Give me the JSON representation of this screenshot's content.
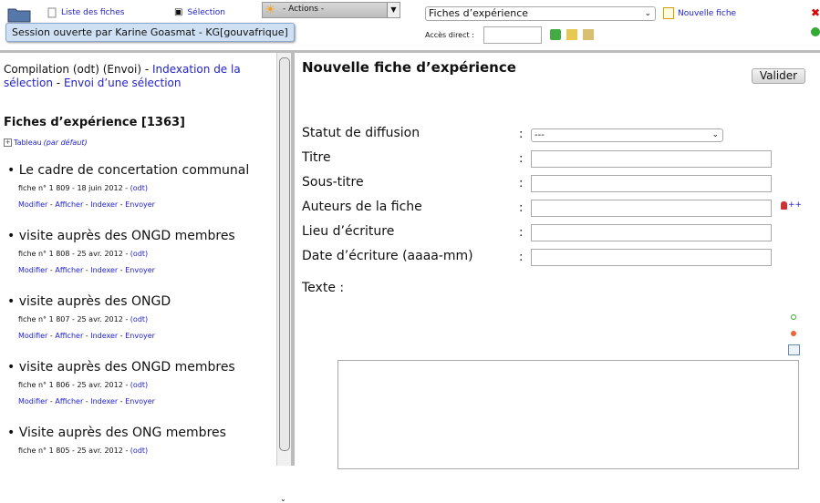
{
  "toolbar": {
    "liste_label": "Liste des fiches",
    "selection_label": "Sélection",
    "actions_label": "- Actions -",
    "type_select": "Fiches d’expérience",
    "new_fiche": "Nouvelle fiche",
    "acces_label": "Accès direct :",
    "acces_value": ""
  },
  "session": "Session ouverte par Karine Goasmat - KG[gouvafrique]",
  "left": {
    "compil_prefix": "Compilation (odt) (Envoi) -",
    "compil_link1": "Indexation de la sélection",
    "compil_sep": "-",
    "compil_link2": "Envoi d’une sélection",
    "fiches_title": "Fiches d’expérience [1363]",
    "tableau_label": "Tableau",
    "tableau_default": "(par défaut)",
    "odt": "(odt)",
    "actions": [
      "Modifier",
      "Afficher",
      "Indexer",
      "Envoyer"
    ],
    "entries": [
      {
        "title": "Le cadre de concertation communal",
        "meta": "fiche n° 1 809 - 18 juin 2012 -"
      },
      {
        "title": "visite auprès des ONGD membres",
        "meta": "fiche n° 1 808 - 25 avr. 2012 -"
      },
      {
        "title": "visite auprès des ONGD",
        "meta": "fiche n° 1 807 - 25 avr. 2012 -"
      },
      {
        "title": "visite auprès des ONGD membres",
        "meta": "fiche n° 1 806 - 25 avr. 2012 -"
      },
      {
        "title": "Visite auprès des ONG membres",
        "meta": "fiche n° 1 805 - 25 avr. 2012 -"
      }
    ]
  },
  "form": {
    "title": "Nouvelle fiche d’expérience",
    "valider": "Valider",
    "statut_label": "Statut de diffusion",
    "statut_value": "---",
    "titre_label": "Titre",
    "soustitre_label": "Sous-titre",
    "auteurs_label": "Auteurs de la fiche",
    "lieu_label": "Lieu d’écriture",
    "date_label": "Date d’écriture (aaaa-mm)",
    "texte_label": "Texte :",
    "colon": ":",
    "add_author": "++"
  }
}
